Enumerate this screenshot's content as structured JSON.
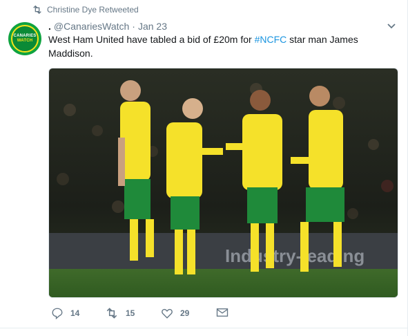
{
  "retweet_context": {
    "text": "Christine Dye Retweeted",
    "icon": "retweet-icon"
  },
  "avatar": {
    "line1": "CANARIES",
    "line2": "WATCH",
    "bg_color": "#0fa340",
    "accent_color": "#f7e31b"
  },
  "author": {
    "name": ".",
    "handle": "@CanariesWatch",
    "separator": "·",
    "date": "Jan 23"
  },
  "tweet": {
    "text_before": "West Ham United have tabled a bid of £20m for ",
    "hashtag": "#NCFC",
    "text_after": " star man James Maddison."
  },
  "media": {
    "banner_text": "Industry-leading",
    "kit_color": "#f5e12a",
    "shorts_color": "#1f8a3a"
  },
  "actions": {
    "reply_count": "14",
    "retweet_count": "15",
    "like_count": "29"
  },
  "colors": {
    "link": "#1b95e0",
    "secondary": "#657786"
  }
}
